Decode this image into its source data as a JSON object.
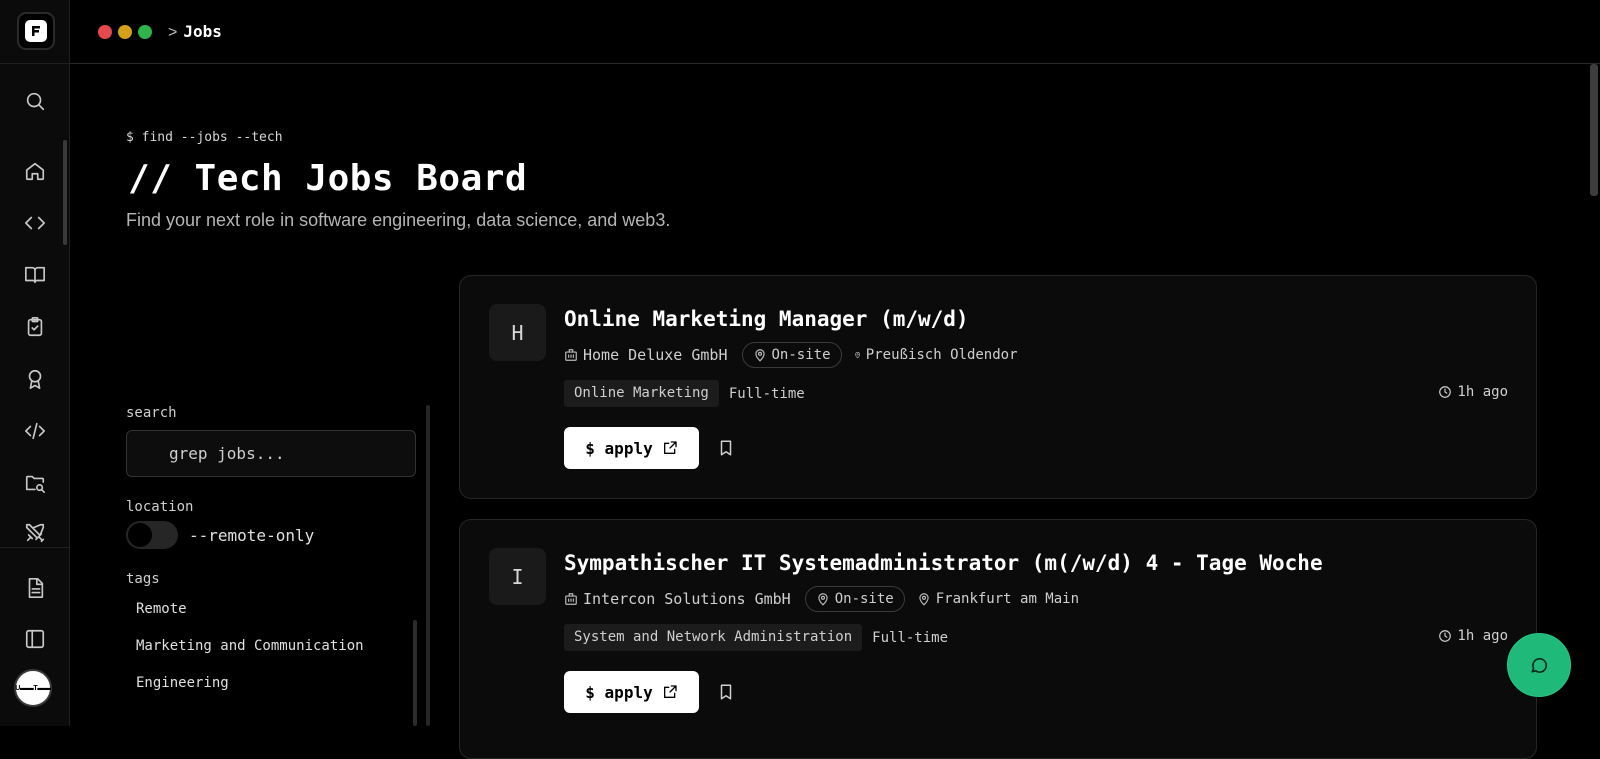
{
  "header": {
    "breadcrumb_sep": ">",
    "breadcrumb_current": "Jobs",
    "window_dots": [
      "#e5484d",
      "#d4a017",
      "#2fb34a"
    ]
  },
  "sidebar": {
    "items": [
      {
        "icon": "search-icon"
      },
      {
        "icon": "home-icon"
      },
      {
        "icon": "code-icon"
      },
      {
        "icon": "book-icon"
      },
      {
        "icon": "clipboard-check-icon"
      },
      {
        "icon": "award-icon"
      },
      {
        "icon": "code-slash-icon"
      },
      {
        "icon": "folder-key-icon"
      },
      {
        "icon": "swords-icon"
      },
      {
        "icon": "document-icon"
      },
      {
        "icon": "sidebar-toggle-icon"
      }
    ],
    "avatar_text": "U▬▬T▬▬"
  },
  "hero": {
    "command": "$ find --jobs --tech",
    "title": "// Tech Jobs Board",
    "subtitle": "Find your next role in software engineering, data science, and web3."
  },
  "filters": {
    "search_label": "search",
    "search_placeholder": "grep jobs...",
    "location_label": "location",
    "remote_toggle_label": "--remote-only",
    "remote_only": false,
    "tags_label": "tags",
    "tags": [
      "Remote",
      "Marketing and Communication",
      "Engineering"
    ]
  },
  "jobs": [
    {
      "initial": "H",
      "title": "Online Marketing Manager (m/w/d)",
      "company": "Home Deluxe GmbH",
      "work_mode": "On-site",
      "location": "Preußisch Oldendor",
      "category": "Online Marketing",
      "employment": "Full-time",
      "posted": "1h ago",
      "apply_label": "$ apply"
    },
    {
      "initial": "I",
      "title": "Sympathischer IT Systemadministrator (m(/w/d) 4 - Tage Woche",
      "company": "Intercon Solutions GmbH",
      "work_mode": "On-site",
      "location": "Frankfurt am Main",
      "category": "System and Network Administration",
      "employment": "Full-time",
      "posted": "1h ago",
      "apply_label": "$ apply"
    }
  ],
  "colors": {
    "accent_fab": "#1fb97a"
  }
}
